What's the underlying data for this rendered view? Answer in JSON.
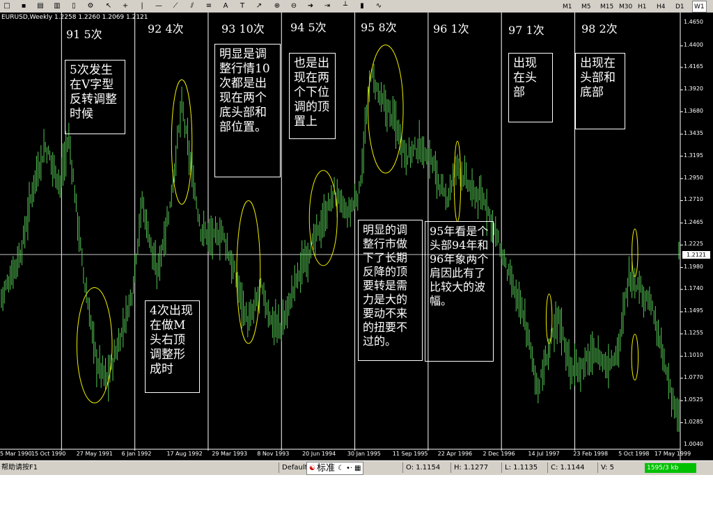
{
  "toolbar": {
    "icons": [
      "new-icon",
      "save-icon",
      "folder-icon",
      "print-icon",
      "document-icon",
      "properties-icon",
      "cursor-icon",
      "crosshair-icon",
      "vertical-line-icon",
      "horizontal-line-icon",
      "trendline-icon",
      "channel-icon",
      "fibonacci-icon",
      "text-icon",
      "label-icon",
      "arrow-icon",
      "zoom-in-icon",
      "zoom-out-icon",
      "scroll-icon",
      "chart-shift-icon",
      "bar-chart-icon",
      "candle-chart-icon",
      "line-chart-icon"
    ],
    "timeframes": [
      "M1",
      "M5",
      "M15",
      "M30",
      "H1",
      "H4",
      "D1",
      "W1"
    ]
  },
  "chart": {
    "title": "EURUSD,Weekly  1.2258 1.2260 1.2069 1.2121",
    "current_price": "1.2121",
    "colors": {
      "background": "#000000",
      "bars": "#55c855",
      "ellipse": "#f2f000",
      "grid": "#ffffff"
    }
  },
  "year_labels": [
    {
      "text": "91  5次"
    },
    {
      "text": "92  4次"
    },
    {
      "text": "93  10次"
    },
    {
      "text": "94  5次"
    },
    {
      "text": "95  8次"
    },
    {
      "text": "96  1次"
    },
    {
      "text": "97  1次"
    },
    {
      "text": "98  2次"
    }
  ],
  "notes": [
    {
      "text": "5次发生在V字型反转调整时候"
    },
    {
      "text": "4次出现在做M头右顶调整形成时"
    },
    {
      "text": "明显是调整行情10次都是出现在两个底头部和部位置。"
    },
    {
      "text": "也是出现在两个下位调的顶置上"
    },
    {
      "text": "明显的调整行市做下了长期反降的顶要转是需力是大的要动不来的扭要不过的。"
    },
    {
      "text": "95年看是个头部94年和96年象两个肩因此有了比较大的波幅。"
    },
    {
      "text": "出现在头部"
    },
    {
      "text": "出现在头部和底部"
    }
  ],
  "chart_data": {
    "type": "bar",
    "symbol": "EURUSD",
    "timeframe": "Weekly",
    "ohlc_last": {
      "open": 1.2258,
      "high": 1.226,
      "low": 1.2069,
      "close": 1.2121
    },
    "ylim": [
      1.004,
      1.465
    ],
    "y_ticks": [
      "1.4650",
      "1.4400",
      "1.4165",
      "1.3920",
      "1.3680",
      "1.3435",
      "1.3195",
      "1.2950",
      "1.2710",
      "1.2465",
      "1.2225",
      "1.1980",
      "1.1740",
      "1.1495",
      "1.1255",
      "1.1010",
      "1.0770",
      "1.0525",
      "1.0285",
      "1.0040"
    ],
    "x_ticks": [
      "5 Mar 1990",
      "15 Oct 1990",
      "27 May 1991",
      "6 Jan 1992",
      "17 Aug 1992",
      "29 Mar 1993",
      "8 Nov 1993",
      "20 Jun 1994",
      "30 Jan 1995",
      "11 Sep 1995",
      "22 Apr 1996",
      "2 Dec 1996",
      "14 Jul 1997",
      "23 Feb 1998",
      "5 Oct 1998",
      "17 May 1999"
    ],
    "price_path": [
      [
        1990.18,
        1.165
      ],
      [
        1990.45,
        1.215
      ],
      [
        1990.62,
        1.29
      ],
      [
        1990.78,
        1.33
      ],
      [
        1990.98,
        1.29
      ],
      [
        1991.1,
        1.34
      ],
      [
        1991.3,
        1.19
      ],
      [
        1991.48,
        1.095
      ],
      [
        1991.62,
        1.075
      ],
      [
        1991.8,
        1.12
      ],
      [
        1991.96,
        1.17
      ],
      [
        1992.1,
        1.27
      ],
      [
        1992.3,
        1.19
      ],
      [
        1992.48,
        1.265
      ],
      [
        1992.64,
        1.375
      ],
      [
        1992.78,
        1.3
      ],
      [
        1992.9,
        1.24
      ],
      [
        1993.05,
        1.23
      ],
      [
        1993.2,
        1.235
      ],
      [
        1993.4,
        1.18
      ],
      [
        1993.55,
        1.135
      ],
      [
        1993.72,
        1.175
      ],
      [
        1993.86,
        1.14
      ],
      [
        1994.0,
        1.13
      ],
      [
        1994.2,
        1.185
      ],
      [
        1994.4,
        1.22
      ],
      [
        1994.55,
        1.245
      ],
      [
        1994.72,
        1.28
      ],
      [
        1994.9,
        1.255
      ],
      [
        1995.06,
        1.28
      ],
      [
        1995.22,
        1.41
      ],
      [
        1995.36,
        1.38
      ],
      [
        1995.54,
        1.36
      ],
      [
        1995.7,
        1.32
      ],
      [
        1995.88,
        1.33
      ],
      [
        1996.05,
        1.315
      ],
      [
        1996.24,
        1.27
      ],
      [
        1996.4,
        1.31
      ],
      [
        1996.6,
        1.28
      ],
      [
        1996.78,
        1.27
      ],
      [
        1996.96,
        1.225
      ],
      [
        1997.14,
        1.18
      ],
      [
        1997.32,
        1.14
      ],
      [
        1997.5,
        1.065
      ],
      [
        1997.62,
        1.1
      ],
      [
        1997.78,
        1.145
      ],
      [
        1997.95,
        1.085
      ],
      [
        1998.1,
        1.09
      ],
      [
        1998.28,
        1.105
      ],
      [
        1998.44,
        1.09
      ],
      [
        1998.6,
        1.11
      ],
      [
        1998.74,
        1.19
      ],
      [
        1998.9,
        1.175
      ],
      [
        1999.05,
        1.155
      ],
      [
        1999.2,
        1.1
      ],
      [
        1999.32,
        1.06
      ],
      [
        1999.42,
        1.03
      ]
    ],
    "dividers": [
      1991.0,
      1992.0,
      1993.0,
      1994.0,
      1995.0,
      1996.0,
      1997.0,
      1998.0
    ],
    "ellipses": [
      {
        "x": 1991.45,
        "y": 1.113,
        "rx": 0.24,
        "ry": 0.063
      },
      {
        "x": 1992.64,
        "y": 1.335,
        "rx": 0.14,
        "ry": 0.068
      },
      {
        "x": 1993.55,
        "y": 1.193,
        "rx": 0.16,
        "ry": 0.078
      },
      {
        "x": 1994.57,
        "y": 1.252,
        "rx": 0.19,
        "ry": 0.052
      },
      {
        "x": 1995.42,
        "y": 1.371,
        "rx": 0.24,
        "ry": 0.07
      },
      {
        "x": 1996.4,
        "y": 1.292,
        "rx": 0.045,
        "ry": 0.044
      },
      {
        "x": 1997.65,
        "y": 1.142,
        "rx": 0.04,
        "ry": 0.027
      },
      {
        "x": 1998.82,
        "y": 1.214,
        "rx": 0.04,
        "ry": 0.026
      },
      {
        "x": 1998.82,
        "y": 1.1,
        "rx": 0.045,
        "ry": 0.025
      }
    ]
  },
  "statusbar": {
    "help": "帮助请按F1",
    "profile": "Default",
    "logo_text": "标准",
    "open": "O: 1.1154",
    "high": "H: 1.1277",
    "low": "L: 1.1135",
    "close": "C: 1.1144",
    "volume": "V: 5",
    "traffic": "1595/3 kb"
  }
}
